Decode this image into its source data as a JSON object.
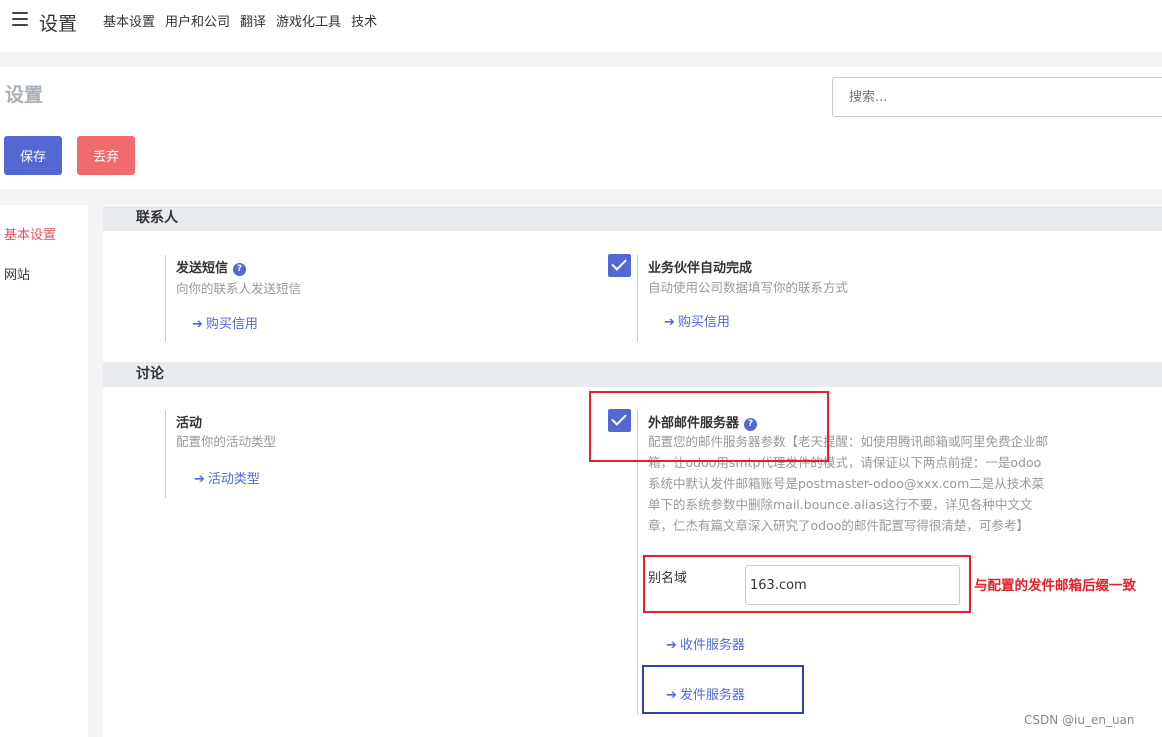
{
  "app_title": "设置",
  "nav_menu": [
    "基本设置",
    "用户和公司",
    "翻译",
    "游戏化工具",
    "技术"
  ],
  "page_title": "设置",
  "search": {
    "placeholder": "搜索..."
  },
  "buttons": {
    "save": "保存",
    "discard": "丢弃"
  },
  "sidebar": {
    "items": [
      "基本设置",
      "网站"
    ]
  },
  "sections": {
    "contacts": {
      "title": "联系人",
      "sms": {
        "title": "发送短信",
        "desc": "向你的联系人发送短信",
        "link": "购买信用"
      },
      "partner": {
        "title": "业务伙伴自动完成",
        "desc": "自动使用公司数据填写你的联系方式",
        "link": "购买信用",
        "checked": true
      }
    },
    "discuss": {
      "title": "讨论",
      "activity": {
        "title": "活动",
        "desc": "配置你的活动类型",
        "link": "活动类型"
      },
      "mail_server": {
        "title": "外部邮件服务器",
        "desc": "配置您的邮件服务器参数【老天提醒：如使用腾讯邮箱或阿里免费企业邮箱，让odoo用smtp代理发件的模式，请保证以下两点前提：一是odoo系统中默认发件邮箱账号是postmaster-odoo@xxx.com二是从技术菜单下的系统参数中删除mail.bounce.alias这行不要，详见各种中文文章，仁杰有篇文章深入研究了odoo的邮件配置写得很清楚，可参考】",
        "checked": true,
        "alias_label": "别名域",
        "alias_value": "163.com",
        "incoming_link": "收件服务器",
        "outgoing_link": "发件服务器"
      }
    }
  },
  "annotation": "与配置的发件邮箱后缀一致",
  "watermark": "CSDN @iu_en_uan",
  "colors": {
    "primary": "#5468d4",
    "danger": "#f06b6e",
    "annotation": "#e8202a",
    "annotation_blue": "#3a3fb0"
  },
  "icons": {
    "menu": "hamburger-icon",
    "help": "question-circle-icon",
    "link": "arrow-right-icon",
    "check": "checkmark-icon"
  }
}
